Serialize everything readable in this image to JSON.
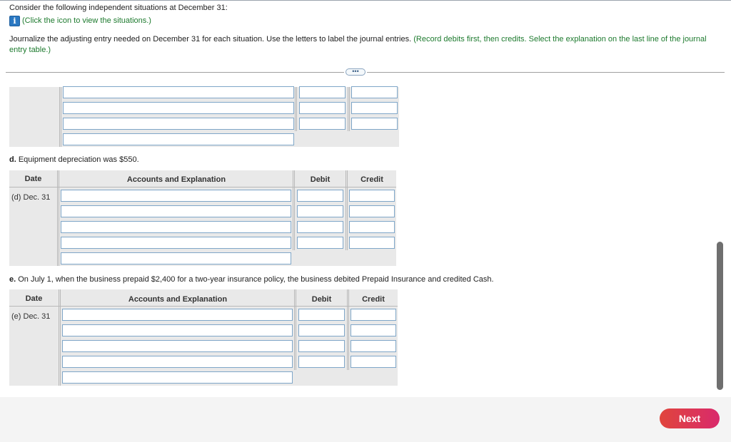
{
  "prompt": "Consider the following independent situations at December 31:",
  "info_link": "(Click the icon to view the situations.)",
  "info_icon": "info-icon",
  "instructions": {
    "main": "Journalize the adjusting entry needed on December 31 for each situation. Use the letters to label the journal entries.",
    "note": "(Record debits first, then credits. Select the explanation on the last line of the journal entry table.)"
  },
  "more_button": "•••",
  "section_d": {
    "label_letter": "d.",
    "label_text": "Equipment depreciation was $550.",
    "headers": {
      "date": "Date",
      "accounts": "Accounts and Explanation",
      "debit": "Debit",
      "credit": "Credit"
    },
    "date_value": "(d) Dec. 31"
  },
  "section_e": {
    "label_letter": "e.",
    "label_text": "On July 1, when the business prepaid $2,400 for a two-year insurance policy, the business debited Prepaid Insurance and credited Cash.",
    "headers": {
      "date": "Date",
      "accounts": "Accounts and Explanation",
      "debit": "Debit",
      "credit": "Credit"
    },
    "date_value": "(e) Dec. 31"
  },
  "next_button": "Next",
  "colors": {
    "link_green": "#1d7a2e",
    "field_border": "#7fa6c8",
    "next_start": "#e0453c",
    "next_end": "#d92a6c"
  }
}
